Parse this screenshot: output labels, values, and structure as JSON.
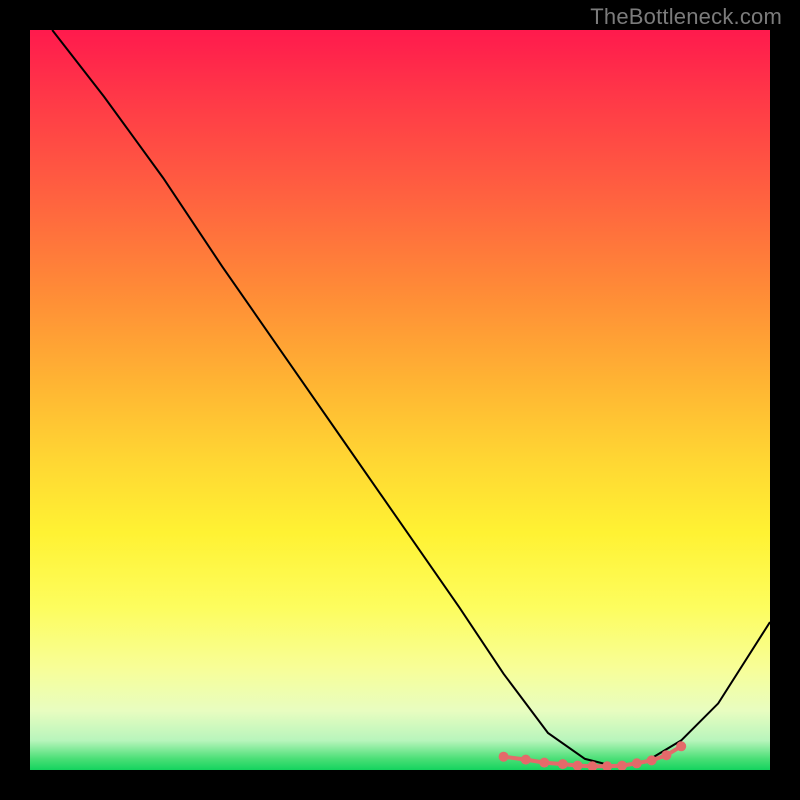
{
  "watermark": "TheBottleneck.com",
  "chart_data": {
    "type": "line",
    "title": "",
    "xlabel": "",
    "ylabel": "",
    "xlim": [
      0,
      100
    ],
    "ylim": [
      0,
      100
    ],
    "series": [
      {
        "name": "curve",
        "x": [
          3,
          10,
          18,
          26,
          34,
          42,
          50,
          58,
          64,
          70,
          75,
          79,
          83,
          88,
          93,
          100
        ],
        "y": [
          100,
          91,
          80,
          68,
          56.5,
          45,
          33.5,
          22,
          13,
          5,
          1.5,
          0.5,
          1,
          4,
          9,
          20
        ],
        "stroke": "#000000",
        "stroke_width": 2
      },
      {
        "name": "highlight",
        "type": "scatter-line",
        "x": [
          64,
          67,
          69.5,
          72,
          74,
          76,
          78,
          80,
          82,
          84,
          86,
          88
        ],
        "y": [
          1.8,
          1.4,
          1.0,
          0.8,
          0.6,
          0.5,
          0.5,
          0.6,
          0.9,
          1.3,
          2.0,
          3.2
        ],
        "stroke": "#e46a6a",
        "stroke_width": 4,
        "marker_radius": 5
      }
    ],
    "background_gradient_stops": [
      {
        "pos": 0,
        "color": "#ff1a4d"
      },
      {
        "pos": 50,
        "color": "#ffcc33"
      },
      {
        "pos": 80,
        "color": "#fff96b"
      },
      {
        "pos": 100,
        "color": "#14d35e"
      }
    ]
  }
}
